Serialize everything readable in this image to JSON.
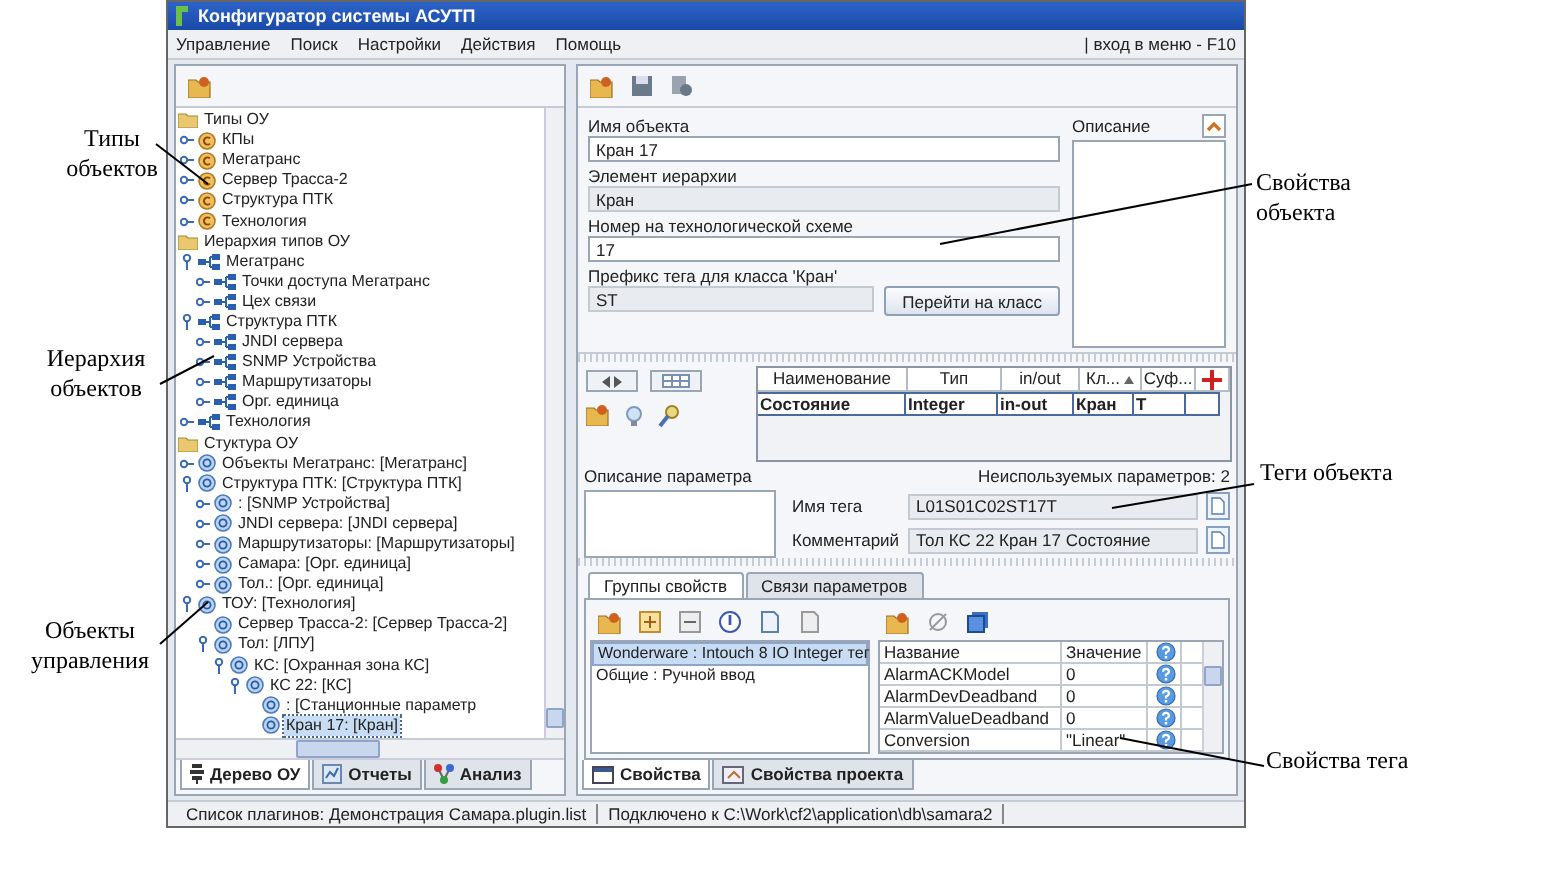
{
  "window": {
    "title": "Конфигуратор системы АСУТП"
  },
  "menu": [
    "Управление",
    "Поиск",
    "Настройки",
    "Действия",
    "Помощь"
  ],
  "menu_hint": "| вход в меню - F10",
  "tree": [
    {
      "label": "Типы ОУ",
      "kind": "folder",
      "selected": false,
      "children": [
        {
          "label": "КПы",
          "kind": "class",
          "expanded": false,
          "selected": false
        },
        {
          "label": "Мегатранс",
          "kind": "class",
          "expanded": false,
          "selected": false
        },
        {
          "label": "Сервер Трасса-2",
          "kind": "class",
          "expanded": false,
          "selected": false
        },
        {
          "label": "Структура ПТК",
          "kind": "class",
          "expanded": false,
          "selected": false
        },
        {
          "label": "Технология",
          "kind": "class",
          "expanded": false,
          "selected": false
        }
      ]
    },
    {
      "label": "Иерархия типов ОУ",
      "kind": "folder",
      "selected": false,
      "children": [
        {
          "label": "Мегатранс",
          "kind": "hierarchy",
          "expanded": true,
          "selected": false,
          "children": [
            {
              "label": "Точки доступа Мегатранс",
              "kind": "hierarchy",
              "expanded": false,
              "selected": false
            },
            {
              "label": "Цех связи",
              "kind": "hierarchy",
              "expanded": false,
              "selected": false
            }
          ]
        },
        {
          "label": "Структура ПТК",
          "kind": "hierarchy",
          "expanded": true,
          "selected": false,
          "children": [
            {
              "label": "JNDI сервера",
              "kind": "hierarchy",
              "expanded": false,
              "selected": false
            },
            {
              "label": "SNMP Устройства",
              "kind": "hierarchy",
              "expanded": false,
              "selected": false
            },
            {
              "label": "Маршрутизаторы",
              "kind": "hierarchy",
              "expanded": false,
              "selected": false
            },
            {
              "label": "Орг. единица",
              "kind": "hierarchy",
              "expanded": false,
              "selected": false
            }
          ]
        },
        {
          "label": "Технология",
          "kind": "hierarchy",
          "expanded": false,
          "selected": false
        }
      ]
    },
    {
      "label": "Стуктура ОУ",
      "kind": "folder",
      "selected": false,
      "children": [
        {
          "label": "Объекты Мегатранс: [Мегатранс]",
          "kind": "object",
          "expanded": false,
          "selected": false
        },
        {
          "label": "Структура ПТК: [Структура ПТК]",
          "kind": "object",
          "expanded": true,
          "selected": false,
          "children": [
            {
              "label": ": [SNMP Устройства]",
              "kind": "object",
              "expanded": false,
              "selected": false
            },
            {
              "label": "JNDI сервера: [JNDI сервера]",
              "kind": "object",
              "expanded": false,
              "selected": false
            },
            {
              "label": "Маршрутизаторы: [Маршрутизаторы]",
              "kind": "object",
              "expanded": false,
              "selected": false
            },
            {
              "label": "Самара: [Орг. единица]",
              "kind": "object",
              "expanded": false,
              "selected": false
            },
            {
              "label": "Тол.: [Орг. единица]",
              "kind": "object",
              "expanded": false,
              "selected": false
            }
          ]
        },
        {
          "label": "ТОУ: [Технология]",
          "kind": "object",
          "expanded": true,
          "selected": false,
          "children": [
            {
              "label": "Сервер Трасса-2: [Сервер Трасса-2]",
              "kind": "object",
              "selected": false
            },
            {
              "label": "Тол: [ЛПУ]",
              "kind": "object",
              "expanded": true,
              "selected": false,
              "children": [
                {
                  "label": "КС: [Охранная зона КС]",
                  "kind": "object",
                  "expanded": true,
                  "selected": false,
                  "children": [
                    {
                      "label": "КС 22: [КС]",
                      "kind": "object",
                      "expanded": true,
                      "selected": false,
                      "children": [
                        {
                          "label": ": [Станционные параметр",
                          "kind": "object",
                          "selected": false
                        },
                        {
                          "label": "Кран 17: [Кран]",
                          "kind": "object",
                          "selected": true
                        }
                      ]
                    }
                  ]
                }
              ]
            }
          ]
        }
      ]
    }
  ],
  "left_tabs": [
    {
      "label": "Дерево ОУ",
      "selected": true
    },
    {
      "label": "Отчеты",
      "selected": false
    },
    {
      "label": "Анализ",
      "selected": false
    }
  ],
  "object_form": {
    "fields": [
      {
        "label": "Имя объекта",
        "value": "Кран 17",
        "disabled": false
      },
      {
        "label": "Элемент иерархии",
        "value": "Кран",
        "disabled": true
      },
      {
        "label": "Номер на технологической схеме",
        "value": "17",
        "disabled": false
      },
      {
        "label": "Префикс тега для класса 'Кран'",
        "value": "ST",
        "disabled": true
      }
    ],
    "goto_button": "Перейти на класс",
    "description_label": "Описание"
  },
  "parameters": {
    "columns": [
      "Наименование",
      "Тип",
      "in/out",
      "Кл...",
      "Суф..."
    ],
    "rows": [
      [
        "Состояние",
        "Integer",
        "in-out",
        "Кран",
        "T"
      ]
    ],
    "description_label": "Описание параметра",
    "unused": "Неиспользуемых параметров: 2",
    "tag_fields": [
      {
        "label": "Имя тега",
        "value": "L01S01C02ST17T"
      },
      {
        "label": "Комментарий",
        "value": "Тол КС 22 Кран 17 Состояние"
      }
    ]
  },
  "property_tabs": [
    {
      "label": "Группы свойств",
      "selected": true
    },
    {
      "label": "Связи параметров",
      "selected": false
    }
  ],
  "groups": [
    {
      "text": "Wonderware : Intouch 8 IO Integer тег",
      "selected": true
    },
    {
      "text": "Общие : Ручной ввод",
      "selected": false
    }
  ],
  "properties": {
    "columns": [
      "Название",
      "Значение"
    ],
    "rows": [
      [
        "AlarmACKModel",
        "0"
      ],
      [
        "AlarmDevDeadband",
        "0"
      ],
      [
        "AlarmValueDeadband",
        "0"
      ],
      [
        "Conversion",
        "\"Linear\""
      ]
    ]
  },
  "bottom_tabs": [
    {
      "label": "Свойства",
      "selected": true
    },
    {
      "label": "Свойства проекта",
      "selected": false
    }
  ],
  "status_bar": [
    "Список плагинов: Демонстрация Самара.plugin.list",
    "Подключено к C:\\Work\\cf2\\application\\db\\samara2"
  ],
  "callouts": [
    {
      "text": "Типы объектов"
    },
    {
      "text": "Иерархия объектов"
    },
    {
      "text": "Объекты управления"
    },
    {
      "text": "Свойства объекта"
    },
    {
      "text": "Теги объекта"
    },
    {
      "text": "Свойства тега"
    }
  ]
}
